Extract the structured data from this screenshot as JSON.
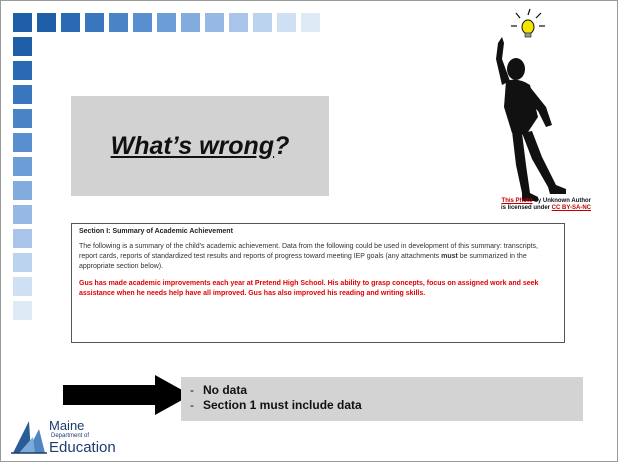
{
  "slide": {
    "title_main": "What’s wrong",
    "title_punct": "?"
  },
  "credit": {
    "photo_link": "This Photo",
    "by_text": " by Unknown Author",
    "licensed_text": "is licensed under ",
    "license_link": "CC BY-SA-NC"
  },
  "document": {
    "heading": "Section I:  Summary of Academic Achievement",
    "para_before": "The following is a summary of the child’s academic achievement.  Data from the following could be used in development of this summary: transcripts, report cards, reports of standardized test results and reports of progress toward meeting IEP goals (any attachments ",
    "para_bold": "must",
    "para_after": " be summarized in the appropriate section below).",
    "red_text": "Gus has made academic improvements each year at Pretend High School.  His ability to grasp concepts, focus on assigned work and seek assistance when he needs help have all improved.  Gus has also improved his reading and writing skills."
  },
  "notes": {
    "items": [
      {
        "dash": "-",
        "text": "No data"
      },
      {
        "dash": "-",
        "text": "Section 1 must include data"
      }
    ]
  },
  "logo": {
    "line1": "Maine",
    "line2": "Department of",
    "line3": "Education"
  },
  "colors": {
    "square_dark": "#1f5fa8",
    "square_mid": "#5a8fcf",
    "square_light": "#a9c6ea",
    "square_faint": "#d5e4f5",
    "red": "#e00000",
    "bulb": "#f5e400"
  },
  "icons": {
    "figure": "person-with-lightbulb-icon",
    "arrow": "right-arrow-icon",
    "logo": "maine-doe-logo-icon"
  }
}
